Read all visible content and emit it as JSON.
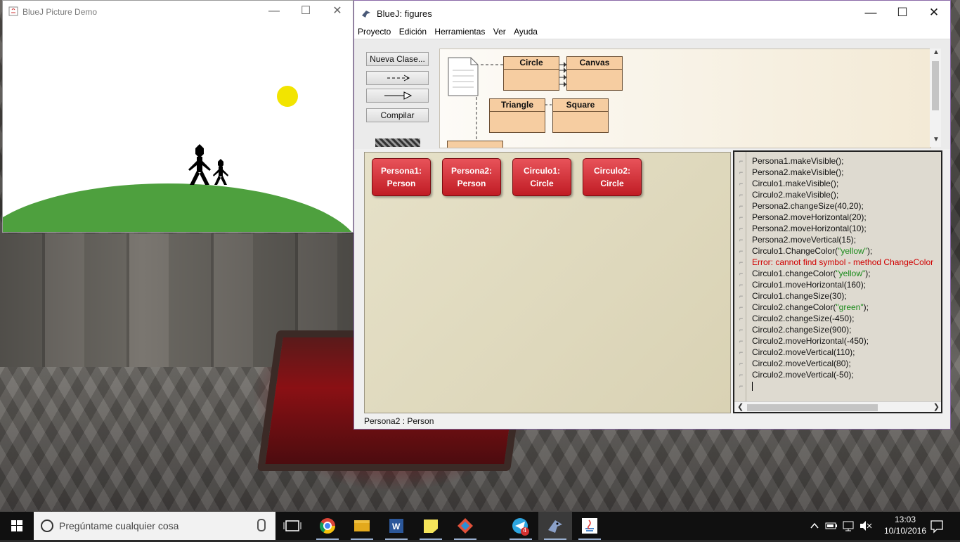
{
  "picture_window": {
    "title": "BlueJ Picture Demo",
    "controls": {
      "minimize": "—",
      "maximize": "☐",
      "close": "✕"
    }
  },
  "bluej_window": {
    "title": "BlueJ:  figures",
    "controls": {
      "minimize": "—",
      "maximize": "☐",
      "close": "✕"
    },
    "menu": [
      "Proyecto",
      "Edición",
      "Herramientas",
      "Ver",
      "Ayuda"
    ],
    "buttons": {
      "new_class": "Nueva Clase...",
      "uses_arrow": "- - ->",
      "inherits_arrow": "——▷",
      "compile": "Compilar"
    },
    "classes": [
      "Circle",
      "Canvas",
      "Triangle",
      "Square"
    ],
    "objects": [
      {
        "name": "Persona1:",
        "type": "Person"
      },
      {
        "name": "Persona2:",
        "type": "Person"
      },
      {
        "name": "Circulo1:",
        "type": "Circle"
      },
      {
        "name": "Circulo2:",
        "type": "Circle"
      }
    ],
    "codepad_lines": [
      {
        "text": "Persona1.makeVisible();",
        "kind": "code"
      },
      {
        "text": "Persona2.makeVisible();",
        "kind": "code"
      },
      {
        "text": "Circulo1.makeVisible();",
        "kind": "code"
      },
      {
        "text": "Circulo2.makeVisible();",
        "kind": "code"
      },
      {
        "text": "Persona2.changeSize(40,20);",
        "kind": "code"
      },
      {
        "text": "Persona2.moveHorizontal(20);",
        "kind": "code"
      },
      {
        "text": "Persona2.moveHorizontal(10);",
        "kind": "code"
      },
      {
        "text": "Persona2.moveVertical(15);",
        "kind": "code"
      },
      {
        "pre": "Circulo1.ChangeColor(",
        "str": "\"yellow\"",
        "post": ");",
        "kind": "code"
      },
      {
        "text": "Error: cannot find symbol -   method ChangeColor",
        "kind": "error"
      },
      {
        "pre": "Circulo1.changeColor(",
        "str": "\"yellow\"",
        "post": ");",
        "kind": "code"
      },
      {
        "text": "Circulo1.moveHorizontal(160);",
        "kind": "code"
      },
      {
        "text": "Circulo1.changeSize(30);",
        "kind": "code"
      },
      {
        "pre": "Circulo2.changeColor(",
        "str": "\"green\"",
        "post": ");",
        "kind": "code"
      },
      {
        "text": "Circulo2.changeSize(-450);",
        "kind": "code"
      },
      {
        "text": "Circulo2.changeSize(900);",
        "kind": "code"
      },
      {
        "text": "Circulo2.moveHorizontal(-450);",
        "kind": "code"
      },
      {
        "text": "Circulo2.moveVertical(110);",
        "kind": "code"
      },
      {
        "text": "Circulo2.moveVertical(80);",
        "kind": "code"
      },
      {
        "text": "Circulo2.moveVertical(-50);",
        "kind": "code"
      }
    ],
    "status": "Persona2 : Person"
  },
  "taskbar": {
    "search_placeholder": "Pregúntame cualquier cosa",
    "apps": [
      "task-view",
      "chrome",
      "file-explorer",
      "word",
      "sticky-notes",
      "git",
      "telegram",
      "bluej",
      "java"
    ],
    "telegram_badge": "4",
    "time": "13:03",
    "date": "10/10/2016"
  },
  "colors": {
    "sun": "#f2e400",
    "hill": "#4ea03e",
    "class_fill": "#f6cda1",
    "object_fill": "#d9343c",
    "error_text": "#d00000",
    "string_literal": "#1a8a1a"
  }
}
